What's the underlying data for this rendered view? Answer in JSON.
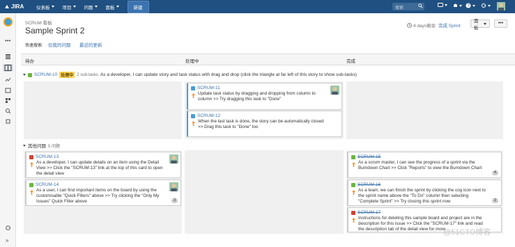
{
  "nav": {
    "logo": "JIRA",
    "items": [
      "仪表板",
      "项目",
      "问题",
      "面板"
    ],
    "create": "新建",
    "search_placeholder": "搜索"
  },
  "header": {
    "board_type": "SCRUM 看板",
    "title": "Sample Sprint 2",
    "days_left": "4 days剩余",
    "complete": "完成 Sprint",
    "board_button": "面板",
    "more_button": "•••",
    "quick_filters_label": "快速搜索:",
    "quick_filters": [
      "仅我的问题",
      "最近的更新"
    ]
  },
  "columns": [
    "待办",
    "处理中",
    "完成"
  ],
  "lane1": {
    "key": "SCRUM-10",
    "status": "处理中",
    "subtasks": "2 sub-tasks",
    "summary": "As a developer, I can update story and task status with drag and drop (click the triangle at far left of this story to show sub-tasks)",
    "cards": [
      {
        "key": "SCRUM-11",
        "summary": "Update task status by dragging and dropping from column to column >> Try dragging this task to \"Done\""
      },
      {
        "key": "SCRUM-12",
        "summary": "When the last task is done, the story can be automatically closed >> Drag this task to \"Done\" too"
      }
    ]
  },
  "lane2": {
    "title": "其他问题",
    "count": "5 问题",
    "todo": [
      {
        "key": "SCRUM-13",
        "summary": "As a developer, I can update details on an item using the Detail View >> Click the \"SCRUM-13\" link at the top of this card to open the detail view"
      },
      {
        "key": "SCRUM-14",
        "summary": "As a user, I can find important items on the board by using the customisable \"Quick Filters\" above >> Try clicking the \"Only My Issues\" Quick Filter above",
        "badge": "3"
      }
    ],
    "done": [
      {
        "key": "SCRUM-15",
        "summary": "As a scrum master, I can see the progress of a sprint via the Burndown Chart >> Click \"Reports\" to view the Burndown Chart",
        "badge": "4"
      },
      {
        "key": "SCRUM-16",
        "summary": "As a team, we can finish the sprint by clicking the cog icon next to the sprint name above the \"To Do\" column then selecting \"Complete Sprint\" >> Try closing this sprint now",
        "badge": "2"
      },
      {
        "key": "SCRUM-17",
        "summary": "Instructions for deleting this sample board and project are in the description for this issue >> Click the \"SCRUM-17\" link and read the description tab of the detail view for more"
      }
    ]
  },
  "watermark": "@51CTO博客",
  "colors": {
    "nav": "#205081",
    "link": "#3b73af",
    "status": "#ffd351"
  }
}
